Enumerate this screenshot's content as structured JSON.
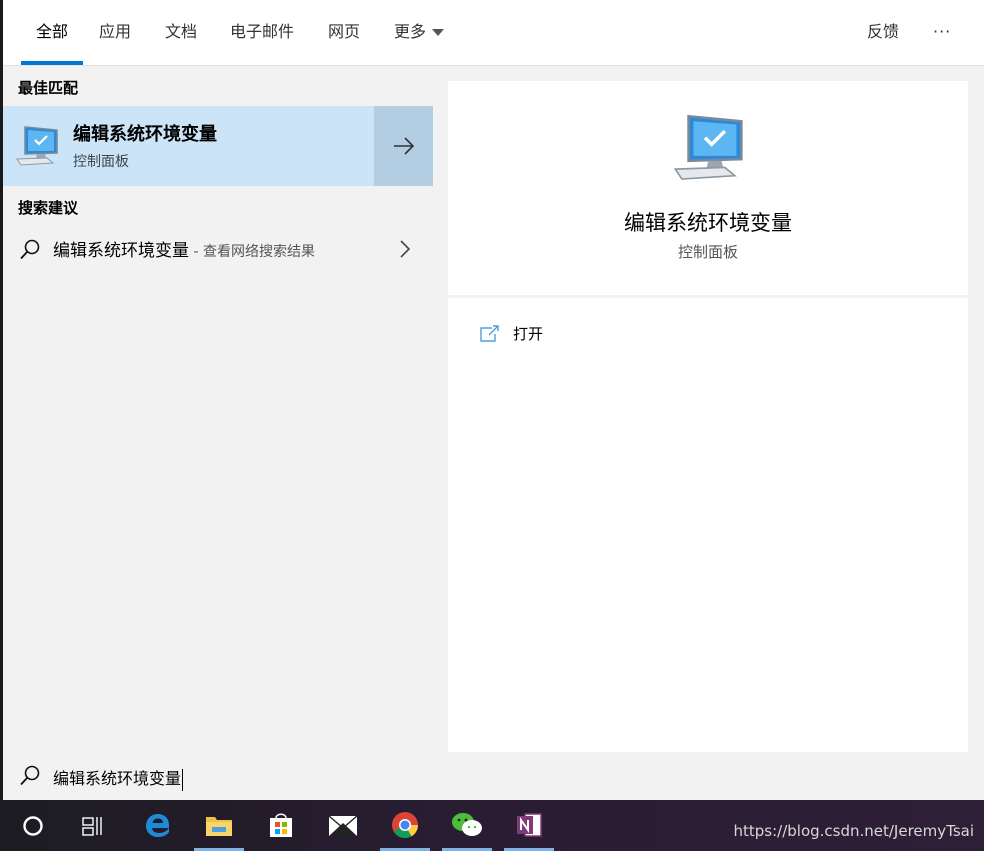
{
  "tabs": [
    {
      "label": "全部",
      "active": true
    },
    {
      "label": "应用"
    },
    {
      "label": "文档"
    },
    {
      "label": "电子邮件"
    },
    {
      "label": "网页"
    },
    {
      "label": "更多"
    }
  ],
  "header": {
    "feedback": "反馈",
    "more_options": "···"
  },
  "left": {
    "best_match_title": "最佳匹配",
    "best_match": {
      "title": "编辑系统环境变量",
      "subtitle": "控制面板",
      "icon": "monitor-icon"
    },
    "suggestions_title": "搜索建议",
    "suggestion": {
      "text": "编辑系统环境变量",
      "suffix": " - 查看网络搜索结果"
    }
  },
  "right": {
    "title": "编辑系统环境变量",
    "subtitle": "控制面板",
    "actions": [
      {
        "label": "打开",
        "icon": "open-icon"
      }
    ]
  },
  "search": {
    "value": "编辑系统环境变量"
  },
  "taskbar": {
    "items": [
      "cortana-icon",
      "task-view-icon",
      "edge-icon",
      "file-explorer-icon",
      "store-icon",
      "mail-icon",
      "chrome-icon",
      "wechat-icon",
      "onenote-icon"
    ],
    "watermark": "https://blog.csdn.net/JeremyTsai"
  },
  "colors": {
    "accent": "#0078d7",
    "selected_bg": "#cce4f7",
    "arrow_bg": "#b3cde3"
  }
}
